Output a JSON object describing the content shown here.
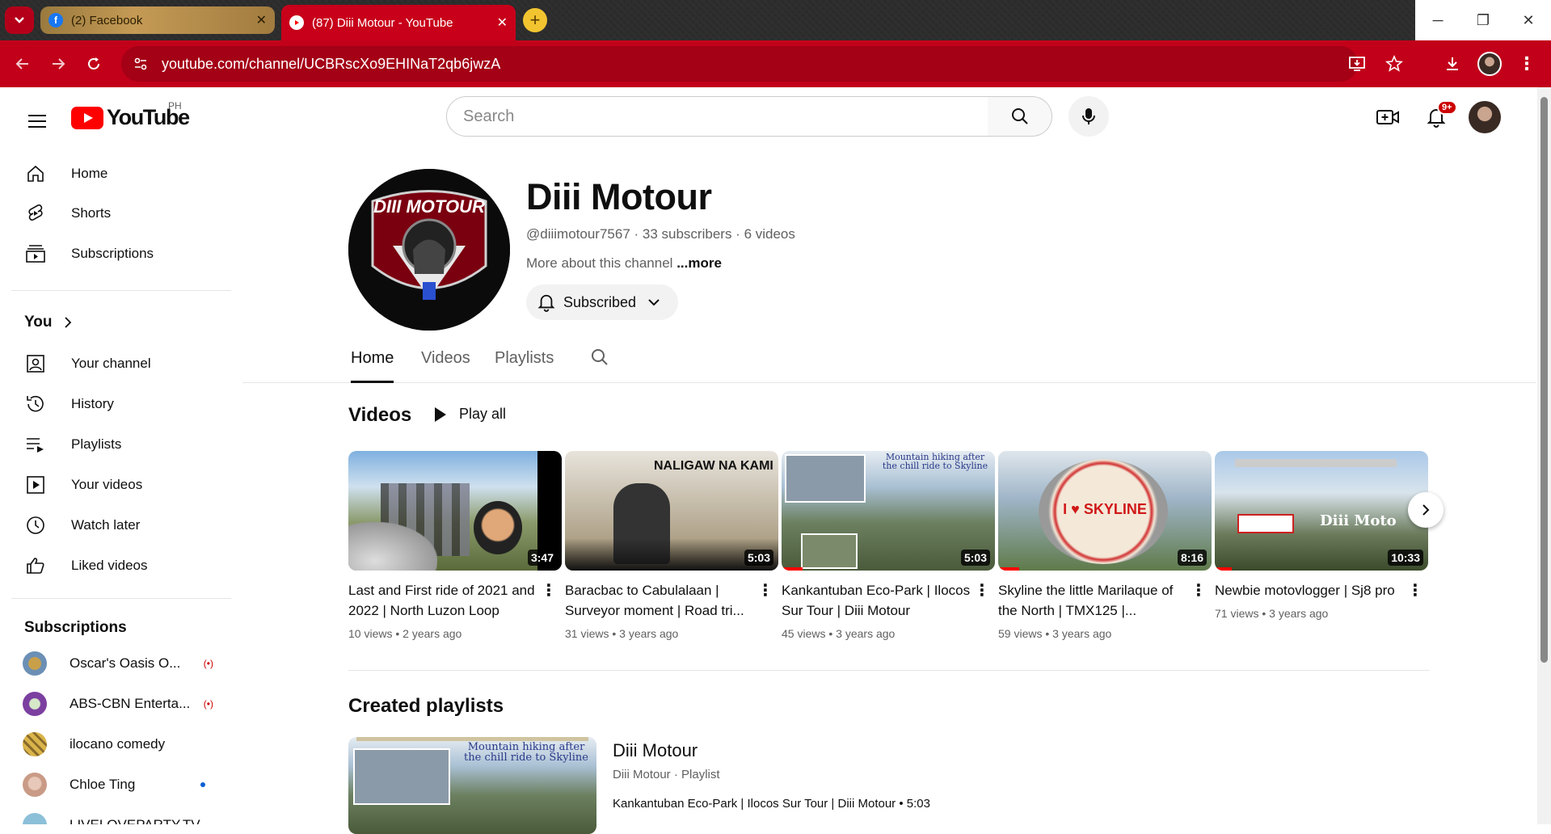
{
  "browser": {
    "tabs": [
      {
        "title": "(2) Facebook",
        "active": false
      },
      {
        "title": "(87) Diii Motour - YouTube",
        "active": true
      }
    ],
    "url": "youtube.com/channel/UCBRscXo9EHINaT2qb6jwzA",
    "accent_color": "#c2001a"
  },
  "masthead": {
    "logo_text": "YouTube",
    "country_code": "PH",
    "search_placeholder": "Search",
    "notification_badge": "9+"
  },
  "sidebar": {
    "main": [
      {
        "label": "Home",
        "icon": "home-icon"
      },
      {
        "label": "Shorts",
        "icon": "shorts-icon"
      },
      {
        "label": "Subscriptions",
        "icon": "subscriptions-icon"
      }
    ],
    "you_header": "You",
    "you": [
      {
        "label": "Your channel",
        "icon": "your-channel-icon"
      },
      {
        "label": "History",
        "icon": "history-icon"
      },
      {
        "label": "Playlists",
        "icon": "playlists-icon"
      },
      {
        "label": "Your videos",
        "icon": "your-videos-icon"
      },
      {
        "label": "Watch later",
        "icon": "watch-later-icon"
      },
      {
        "label": "Liked videos",
        "icon": "liked-videos-icon"
      }
    ],
    "subscriptions_header": "Subscriptions",
    "subscriptions": [
      {
        "name": "Oscar's Oasis O...",
        "status": "live",
        "color": "#6b8fb5"
      },
      {
        "name": "ABS-CBN Enterta...",
        "status": "live",
        "color": "#7b3fa0"
      },
      {
        "name": "ilocano comedy",
        "status": "",
        "color": "#d9b44a"
      },
      {
        "name": "Chloe Ting",
        "status": "new",
        "color": "#c99b87"
      },
      {
        "name": "LIVELOVEPARTY.TV",
        "status": "",
        "color": "#8cc0d8"
      }
    ]
  },
  "channel": {
    "name": "Diii Motour",
    "handle": "@diiimotour7567",
    "subscribers": "33 subscribers",
    "videos_count": "6 videos",
    "about": "More about this channel",
    "about_more": "...more",
    "subscribe_label": "Subscribed",
    "avatar_text": "DIII MOTOUR"
  },
  "channel_tabs": [
    "Home",
    "Videos",
    "Playlists"
  ],
  "videos_section": {
    "title": "Videos",
    "play_all": "Play all",
    "items": [
      {
        "title": "Last and First ride of 2021 and 2022 | North Luzon Loop",
        "views": "10 views",
        "age": "2 years ago",
        "duration": "3:47",
        "thumb_text": "",
        "watched": 0
      },
      {
        "title": "Baracbac to Cabulalaan | Surveyor moment | Road tri...",
        "views": "31 views",
        "age": "3 years ago",
        "duration": "5:03",
        "thumb_text": "NALIGAW NA KAMI",
        "watched": 0
      },
      {
        "title": "Kankantuban Eco-Park | Ilocos Sur Tour | Diii Motour",
        "views": "45 views",
        "age": "3 years ago",
        "duration": "5:03",
        "thumb_text": "Mountain hiking after the chill ride to Skyline",
        "watched": 0.1
      },
      {
        "title": "Skyline the little Marilaque of the North | TMX125 |...",
        "views": "59 views",
        "age": "3 years ago",
        "duration": "8:16",
        "thumb_text": "I ♥ SKYLINE",
        "watched": 0.1
      },
      {
        "title": "Newbie motovlogger | Sj8 pro",
        "views": "71 views",
        "age": "3 years ago",
        "duration": "10:33",
        "thumb_text": "Diii Moto",
        "watched": 0.08
      }
    ]
  },
  "playlists_section": {
    "title": "Created playlists",
    "playlist_title": "Diii Motour",
    "playlist_sub": "Diii Motour · Playlist",
    "first_item": "Kankantuban Eco-Park | Ilocos Sur Tour | Diii Motour • 5:03",
    "thumb_text": "Mountain hiking after the chill ride to Skyline"
  }
}
